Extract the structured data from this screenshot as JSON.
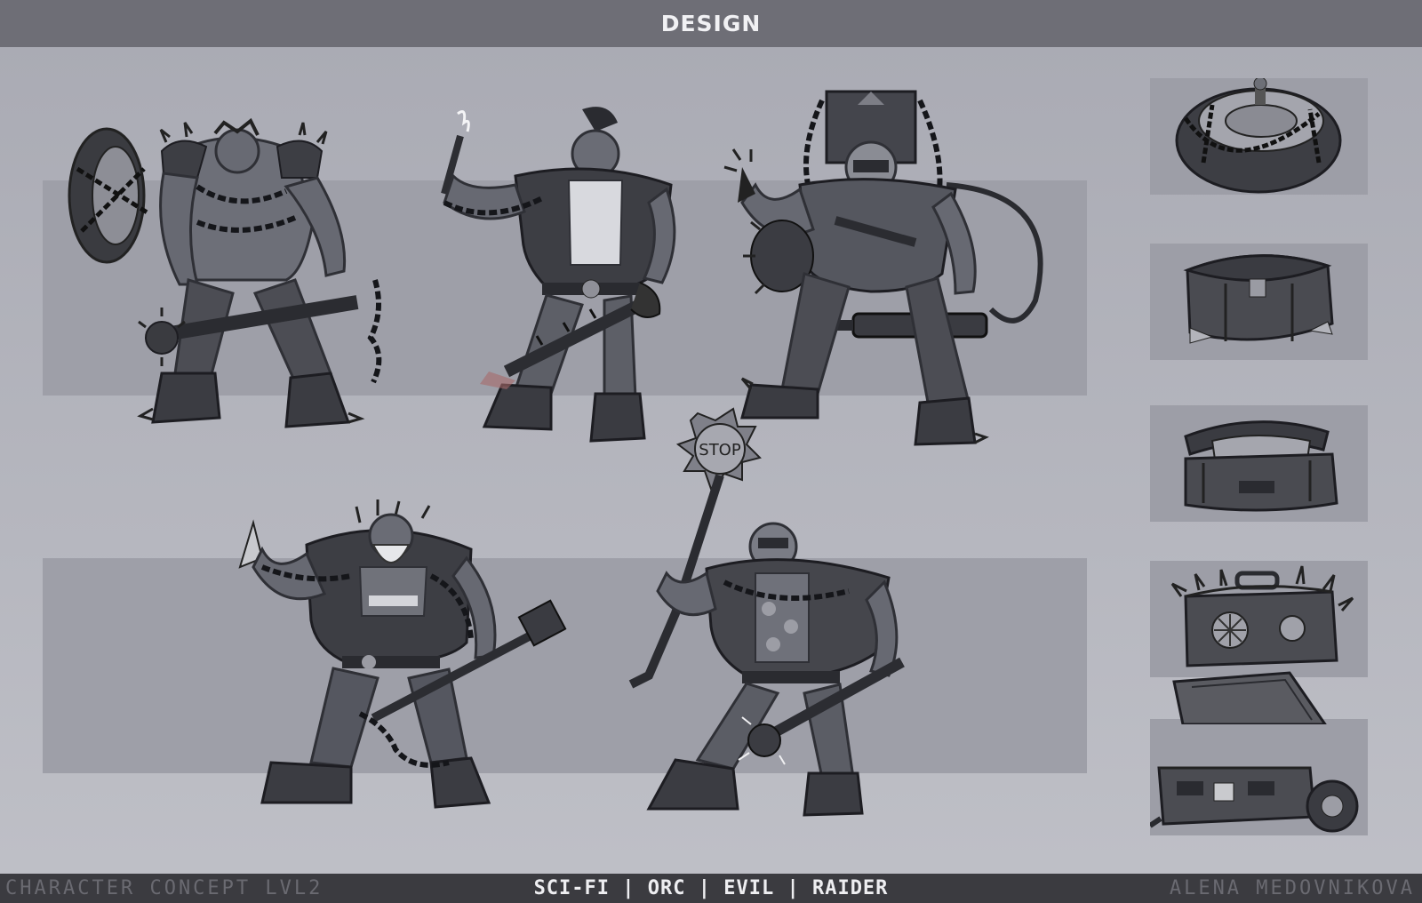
{
  "header": {
    "title": "DESIGN"
  },
  "footer": {
    "left": "CHARACTER CONCEPT LVL2",
    "center": "SCI-FI | ORC | EVIL | RAIDER",
    "right": "ALENA MEDOVNIKOVA"
  },
  "illustrations": {
    "characters": [
      {
        "name": "orc-raider-tire-shield"
      },
      {
        "name": "orc-raider-torch-mohawk"
      },
      {
        "name": "orc-raider-tank-backpack"
      },
      {
        "name": "orc-raider-bearded-hammer"
      },
      {
        "name": "orc-raider-stop-sign-mace"
      }
    ],
    "props": [
      {
        "name": "chained-tire"
      },
      {
        "name": "closed-crate"
      },
      {
        "name": "open-chest"
      },
      {
        "name": "spiked-safe"
      },
      {
        "name": "trailer-box-wheel"
      }
    ],
    "props_sign_text": "STOP",
    "colors": {
      "background": "#b0b1b9",
      "header": "#6e6e76",
      "footer": "#3b3b40",
      "band": "#9e9fa8",
      "ink": "#2f3036",
      "skin": "#6d6f78"
    }
  }
}
